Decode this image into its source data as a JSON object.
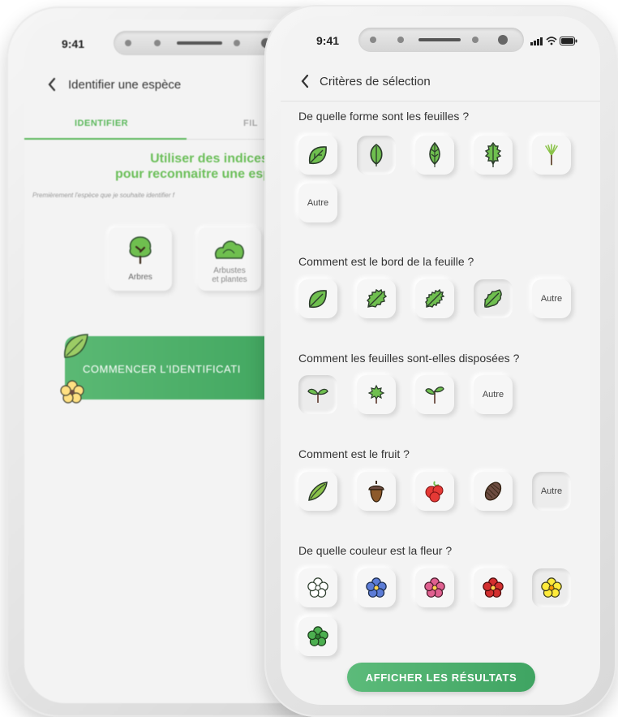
{
  "status": {
    "time": "9:41"
  },
  "back_screen": {
    "title": "Identifier une espèce",
    "tabs": [
      "IDENTIFIER",
      "FIL"
    ],
    "intro_title_1": "Utiliser des indices",
    "intro_title_2": "pour reconnaitre une espèce v",
    "intro_sub": "Premièrement l'espèce que je souhaite identifier f",
    "categories": [
      {
        "label": "Arbres",
        "icon": "tree-icon"
      },
      {
        "label_1": "Arbustes",
        "label_2": "et plantes",
        "icon": "shrub-icon"
      }
    ],
    "cta": "COMMENCER L'IDENTIFICATI"
  },
  "front_screen": {
    "title": "Critères de sélection",
    "questions": [
      {
        "text": "De quelle forme sont les feuilles ?",
        "other": "Autre",
        "icons": [
          "round-leaf-icon",
          "oval-leaf-icon",
          "lanceolate-leaf-icon",
          "serrated-leaf-icon",
          "needle-leaf-icon"
        ]
      },
      {
        "text": "Comment est le bord de la feuille ?",
        "other": "Autre",
        "icons": [
          "smooth-edge-leaf-icon",
          "toothed-edge-leaf-icon",
          "serrate-edge-leaf-icon",
          "lobed-edge-leaf-icon"
        ]
      },
      {
        "text": "Comment les feuilles sont-elles disposées ?",
        "other": "Autre",
        "icons": [
          "opposite-leaves-icon",
          "whorled-leaves-icon",
          "alternate-leaves-icon"
        ]
      },
      {
        "text": "Comment est le fruit ?",
        "other": "Autre",
        "icons": [
          "pod-fruit-icon",
          "acorn-icon",
          "berry-icon",
          "cone-icon"
        ]
      },
      {
        "text": "De quelle couleur est la fleur ?",
        "icons": [
          "white-flower-icon",
          "blue-flower-icon",
          "pink-flower-icon",
          "red-flower-icon",
          "yellow-flower-icon",
          "green-flower-icon"
        ]
      }
    ],
    "results_button": "AFFICHER LES RÉSULTATS"
  },
  "colors": {
    "accent": "#4caf6a",
    "leaf": "#6fbf4f",
    "text": "#333333"
  }
}
